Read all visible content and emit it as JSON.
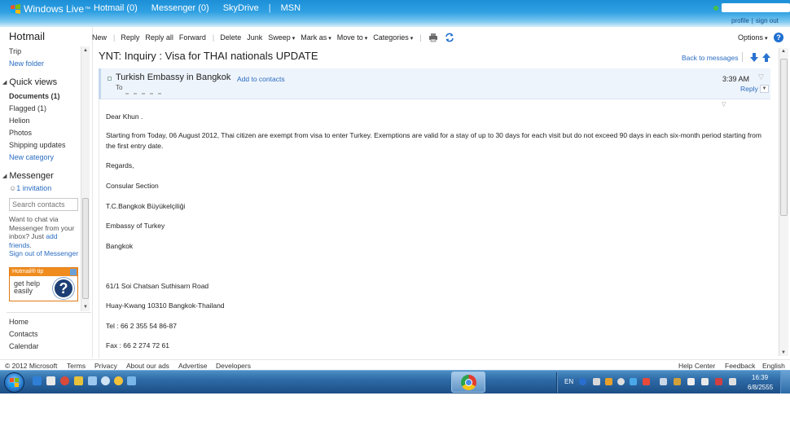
{
  "topbar": {
    "brand": "Windows Live",
    "brand_tm": "™",
    "nav": [
      "Hotmail (0)",
      "Messenger (0)",
      "SkyDrive",
      "MSN"
    ],
    "separator": "|",
    "account_links": [
      "profile",
      "|",
      "sign out"
    ]
  },
  "leftnav": {
    "title": "Hotmail",
    "folders": [
      "Trip"
    ],
    "new_folder": "New folder",
    "quick_views_title": "Quick views",
    "quick_views": [
      "Documents  (1)",
      "Flagged  (1)",
      "Helion",
      "Photos",
      "Shipping updates"
    ],
    "new_category": "New category",
    "messenger_title": "Messenger",
    "invitation": "1 invitation",
    "search_placeholder": "Search contacts",
    "chat_text": "Want to chat via Messenger from your inbox? Just",
    "chat_link": "add friends",
    "chat_end": ".",
    "sign_out_messenger": "Sign out of Messenger",
    "tip_header": "Hotmail® tip",
    "tip_body": "get help easily",
    "tip_icon": "?",
    "bottom_links": [
      "Home",
      "Contacts",
      "Calendar"
    ]
  },
  "toolbar": {
    "new": "New",
    "reply": "Reply",
    "reply_all": "Reply all",
    "forward": "Forward",
    "delete": "Delete",
    "junk": "Junk",
    "sweep": "Sweep",
    "mark_as": "Mark as",
    "move_to": "Move to",
    "categories": "Categories",
    "separator": "|",
    "options": "Options",
    "help": "?"
  },
  "message": {
    "subject": "YNT: Inquiry : Visa for THAI nationals UPDATE",
    "back": "Back to messages",
    "sender": "Turkish Embassy in Bangkok",
    "add_to_contacts": "Add to contacts",
    "to_label": "To",
    "time": "3:39 AM",
    "reply": "Reply",
    "body": [
      "Dear Khun .",
      "Starting from Today, 06 August 2012, Thai citizen are exempt from visa to enter Turkey. Exemptions are valid for a stay of up to 30 days for each visit but do not exceed 90 days in each six-month period starting from the first entry date.",
      "Regards,",
      "Consular Section",
      "T.C.Bangkok Büyükelçiliği",
      "Embassy of Turkey",
      "Bangkok",
      "61/1 Soi Chatsan Suthisarn Road",
      "Huay-Kwang 10310 Bangkok-Thailand",
      "Tel : 66 2 355 54 86-87",
      "Fax : 66 2 274 72 61"
    ]
  },
  "footer": {
    "copyright": "© 2012 Microsoft",
    "links": [
      "Terms",
      "Privacy",
      "About our ads",
      "Advertise",
      "Developers"
    ],
    "right_links": [
      "Help Center",
      "Feedback",
      "English"
    ]
  },
  "taskbar": {
    "language": "EN",
    "time": "16:39",
    "date": "6/8/2555"
  },
  "colors": {
    "link": "#2a6cc0",
    "topbar": "#2fa0e2",
    "taskbar": "#2d6aa6",
    "tip_orange": "#f08c1e"
  }
}
